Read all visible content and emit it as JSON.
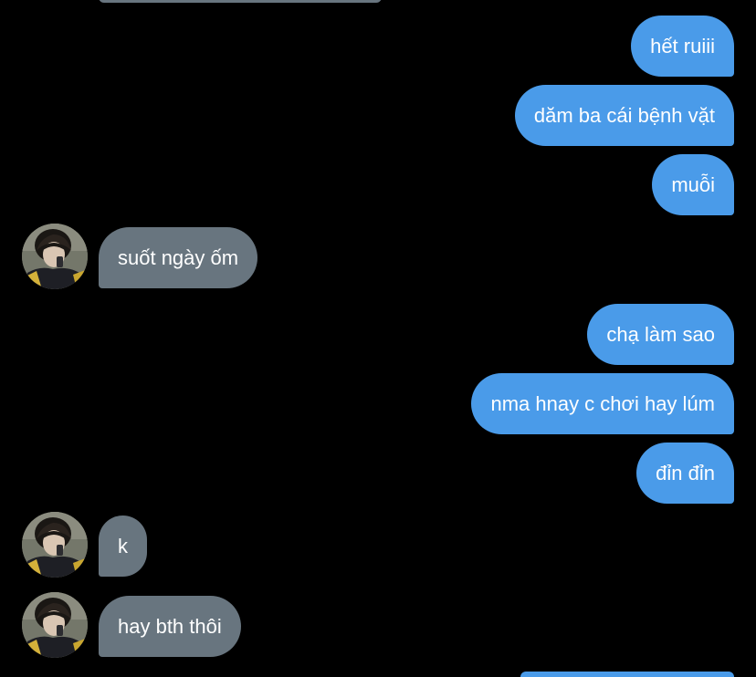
{
  "messages": [
    {
      "side": "outgoing",
      "text": "hết ruiii"
    },
    {
      "side": "outgoing",
      "text": "dăm ba cái bệnh vặt"
    },
    {
      "side": "outgoing",
      "text": "muỗi"
    },
    {
      "side": "incoming",
      "text": "suốt ngày ốm",
      "avatar": "user-avatar"
    },
    {
      "side": "outgoing",
      "text": "chạ làm sao"
    },
    {
      "side": "outgoing",
      "text": "nma hnay c chơi hay lúm"
    },
    {
      "side": "outgoing",
      "text": "đỉn đỉn"
    },
    {
      "side": "incoming",
      "text": "k",
      "avatar": "user-avatar"
    },
    {
      "side": "incoming",
      "text": "hay bth thôi",
      "avatar": "user-avatar"
    }
  ],
  "colors": {
    "background": "#000000",
    "outgoing_bubble": "#4a9be9",
    "incoming_bubble": "#68757f",
    "text": "#ffffff"
  }
}
